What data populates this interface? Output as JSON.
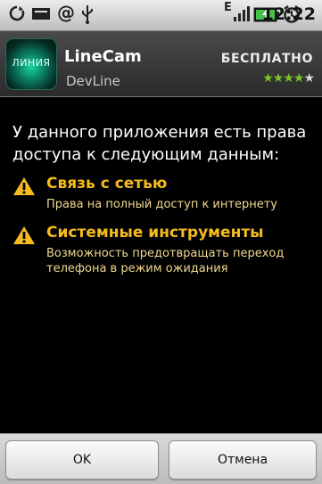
{
  "status_bar": {
    "network_type": "E",
    "time": "12:22",
    "icons": [
      "sync-icon",
      "email-icon",
      "at-icon",
      "usb-icon",
      "signal-icon",
      "battery-icon",
      "alarm-icon"
    ]
  },
  "app": {
    "logo_text": "ЛИНИЯ",
    "name": "LineCam",
    "developer": "DevLine",
    "price": "БЕСПЛАТНО",
    "rating_stars": 4,
    "rating_max": 5
  },
  "intro_text": "У данного приложения есть права доступа к следующим данным:",
  "permissions": [
    {
      "title": "Связь с сетью",
      "description": "Права на полный доступ к интернету",
      "icon": "warning-icon"
    },
    {
      "title": "Системные инструменты",
      "description": "Возможность предотвращать переход телефона в режим ожидания",
      "icon": "warning-icon"
    }
  ],
  "buttons": {
    "ok": "OK",
    "cancel": "Отмена"
  },
  "colors": {
    "permission_title": "#f6bc1e",
    "permission_desc": "#f1d98f",
    "rating": "#79c42a",
    "background": "#000000"
  }
}
